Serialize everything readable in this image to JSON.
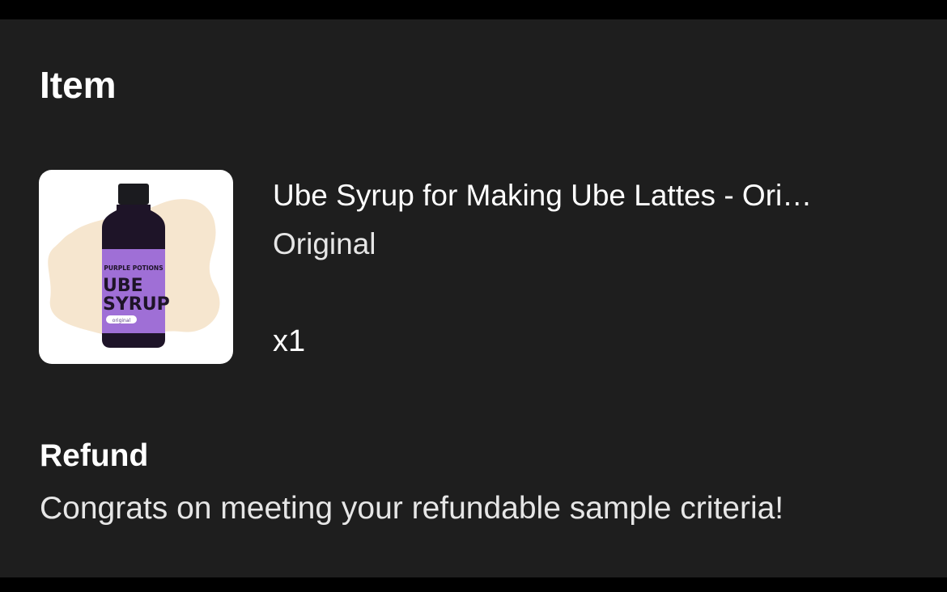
{
  "item_section": {
    "heading": "Item"
  },
  "item": {
    "title": "Ube Syrup for Making Ube Lattes - Ori…",
    "variant": "Original",
    "quantity": "x1",
    "image": {
      "brand": "PURPLE POTIONS",
      "line1": "UBE",
      "line2": "SYRUP",
      "tag": "original"
    }
  },
  "refund": {
    "heading": "Refund",
    "message": "Congrats on meeting your refundable sample criteria!"
  },
  "colors": {
    "background": "#1e1e1e",
    "bars": "#000000",
    "label_purple": "#9f6fd6",
    "bottle_dark": "#1e1428",
    "blob": "#f6e6cf"
  }
}
